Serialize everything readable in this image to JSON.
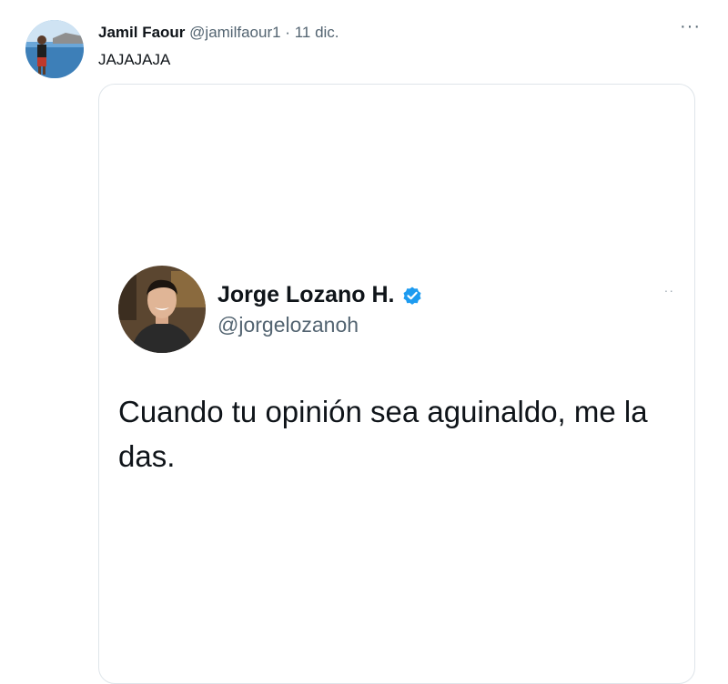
{
  "outer_tweet": {
    "avatar_icon": "profile-photo-icon",
    "name": "Jamil Faour",
    "handle": "@jamilfaour1",
    "separator": "·",
    "date": "11 dic.",
    "more_label": "···",
    "text": "JAJAJAJA"
  },
  "embedded_tweet": {
    "avatar_icon": "profile-photo-icon",
    "name": "Jorge Lozano H.",
    "verified_icon": "verified-badge-icon",
    "verified_color": "#1d9bf0",
    "handle": "@jorgelozanoh",
    "more_label": "··",
    "text": "Cuando tu opinión sea aguinaldo, me la das."
  }
}
